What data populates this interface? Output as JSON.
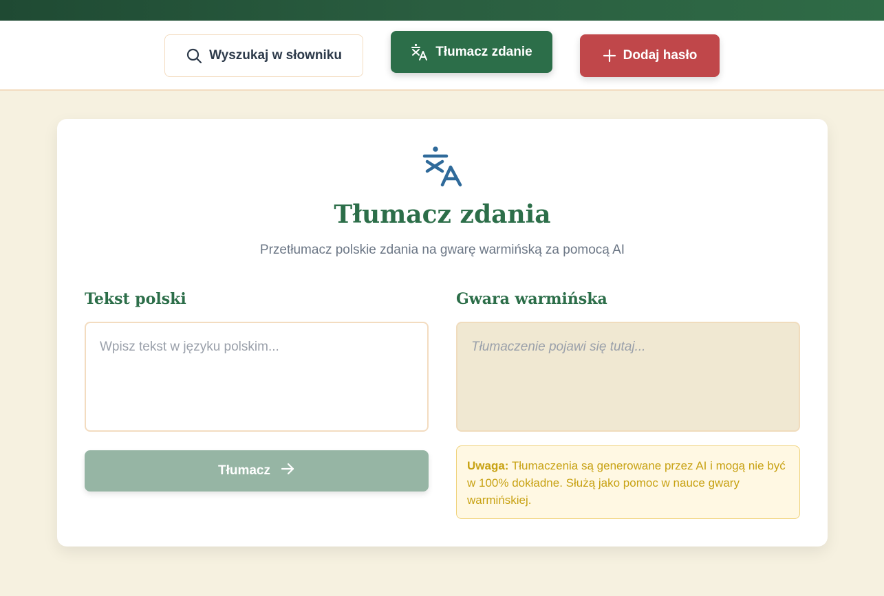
{
  "nav": {
    "search_label": "Wyszukaj w słowniku",
    "translate_label": "Tłumacz zdanie",
    "add_label": "Dodaj hasło"
  },
  "card": {
    "title": "Tłumacz zdania",
    "subtitle": "Przetłumacz polskie zdania na gwarę warmińską za pomocą AI"
  },
  "source": {
    "heading": "Tekst polski",
    "placeholder": "Wpisz tekst w języku polskim...",
    "value": ""
  },
  "target": {
    "heading": "Gwara warmińska",
    "placeholder": "Tłumaczenie pojawi się tutaj..."
  },
  "translate_button": {
    "label": "Tłumacz"
  },
  "notice": {
    "label": "Uwaga:",
    "text": "Tłumaczenia są generowane przez AI i mogą nie być w 100% dokładne. Służą jako pomoc w nauce gwary warmińskiej."
  },
  "colors": {
    "primary": "#2c6e49",
    "danger": "#c0474a",
    "background": "#f6f1e0",
    "accent_icon": "#2f6a9a",
    "notice_text": "#c8a214"
  },
  "icons": {
    "search": "search-icon",
    "translate": "translate-icon",
    "add": "plus-icon",
    "arrow": "arrow-right-icon"
  }
}
